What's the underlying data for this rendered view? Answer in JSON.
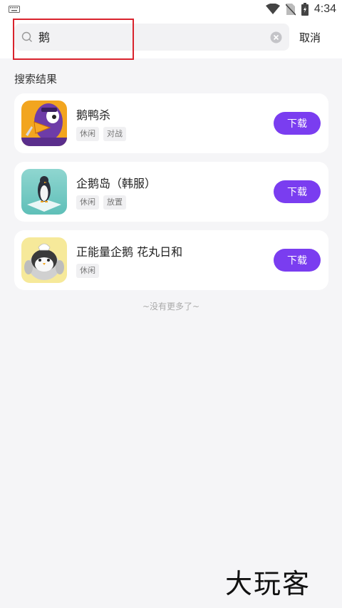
{
  "status": {
    "time": "4:34",
    "icons": [
      "keyboard-icon",
      "wifi-icon",
      "no-sim-icon",
      "battery-icon"
    ]
  },
  "search": {
    "value": "鹅",
    "cancel_label": "取消"
  },
  "results_title": "搜索结果",
  "results": [
    {
      "name": "鹅鸭杀",
      "tags": [
        "休闲",
        "对战"
      ],
      "button": "下载",
      "icon": "goose-duck-app-icon"
    },
    {
      "name": "企鹅岛（韩服）",
      "tags": [
        "休闲",
        "放置"
      ],
      "button": "下载",
      "icon": "penguin-island-app-icon"
    },
    {
      "name": "正能量企鹅 花丸日和",
      "tags": [
        "休闲"
      ],
      "button": "下载",
      "icon": "positive-penguin-app-icon"
    }
  ],
  "no_more": "~没有更多了~",
  "watermark": "大玩客",
  "colors": {
    "accent": "#7a3df0",
    "highlight": "#d9232d",
    "background": "#f5f5f7"
  }
}
